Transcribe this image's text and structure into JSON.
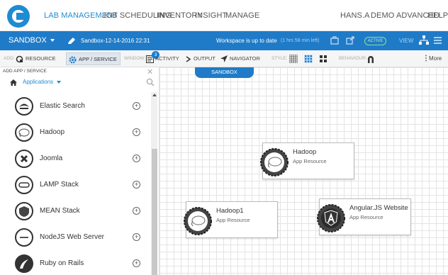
{
  "nav": {
    "items": [
      "LAB MANAGEMENT",
      "JOB SCHEDULING",
      "INVENTORY",
      "INSIGHT",
      "MANAGE"
    ],
    "user": "HANS.A",
    "mode": "DEMO ADVANCED",
    "help": "HELP",
    "accent": "#1e8bd3"
  },
  "bluebar": {
    "sandbox_label": "SANDBOX",
    "sandbox_name": "Sandbox-12-14-2016 22:31",
    "status": "Workspace is up to date",
    "time_left": "(1 hrs 58 min left)",
    "active_badge": "ACTIVE",
    "view_label": "VIEW",
    "color": "#1f7bc8"
  },
  "toolbar": {
    "add_label": "ADD:",
    "resource": "RESOURCE",
    "app_service": "APP / SERVICE",
    "window_label": "WINDOW:",
    "activity": "ACTIVITY",
    "activity_count": "3",
    "output": "OUTPUT",
    "navigator": "NAVIGATOR",
    "style_label": "STYLE:",
    "behaviour_label": "BEHAVIOUR:",
    "more": "More"
  },
  "sidebar": {
    "header": "ADD APP / SERVICE",
    "filter": "Applications",
    "items": [
      {
        "label": "Elastic Search",
        "icon": "elastic-search-icon"
      },
      {
        "label": "Hadoop",
        "icon": "hadoop-elephant-icon"
      },
      {
        "label": "Joomla",
        "icon": "joomla-icon"
      },
      {
        "label": "LAMP Stack",
        "icon": "lamp-icon"
      },
      {
        "label": "MEAN Stack",
        "icon": "mean-stack-icon"
      },
      {
        "label": "NodeJS Web Server",
        "icon": "nodejs-icon"
      },
      {
        "label": "Ruby on Rails",
        "icon": "rails-icon"
      }
    ]
  },
  "canvas": {
    "sandbox_tab": "SANDBOX",
    "resources": [
      {
        "title": "Hadoop",
        "subtitle": "App Resource",
        "icon": "hadoop-elephant-icon"
      },
      {
        "title": "Hadoop1",
        "subtitle": "App Resource",
        "icon": "hadoop-elephant-icon"
      },
      {
        "title": "Angular.JS Website",
        "subtitle": "App Resource",
        "icon": "angular-icon"
      }
    ]
  }
}
